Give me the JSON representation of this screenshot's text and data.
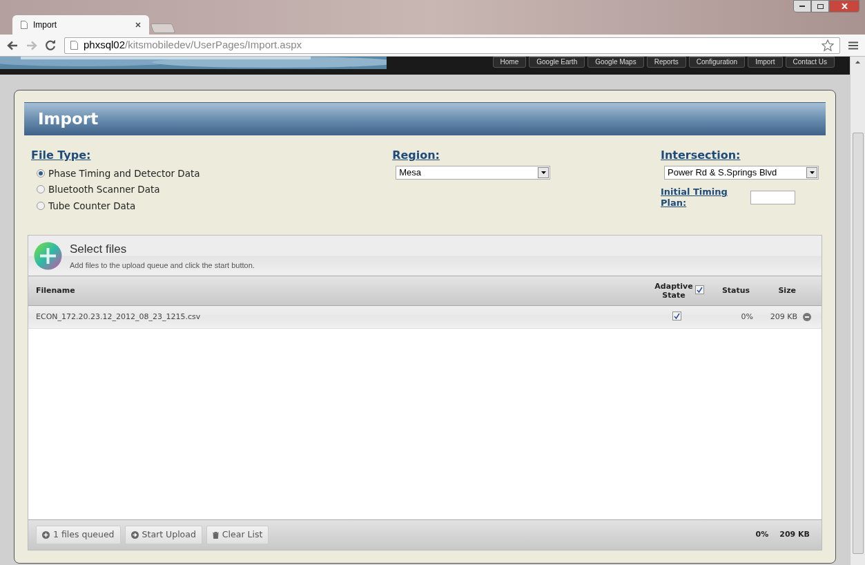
{
  "browser": {
    "tab_title": "Import",
    "url_host": "phxsql02",
    "url_path": "/kitsmobiledev/UserPages/Import.aspx"
  },
  "nav": [
    {
      "label": "Home"
    },
    {
      "label": "Google Earth"
    },
    {
      "label": "Google Maps"
    },
    {
      "label": "Reports"
    },
    {
      "label": "Configuration"
    },
    {
      "label": "Import"
    },
    {
      "label": "Contact Us"
    }
  ],
  "page_title": "Import",
  "file_type": {
    "label": "File Type:",
    "options": [
      {
        "label": "Phase Timing and Detector Data",
        "selected": true
      },
      {
        "label": "Bluetooth Scanner Data",
        "selected": false
      },
      {
        "label": "Tube Counter Data",
        "selected": false
      }
    ]
  },
  "region": {
    "label": "Region:",
    "value": "Mesa"
  },
  "intersection": {
    "label": "Intersection:",
    "value": "Power Rd & S.Springs Blvd"
  },
  "initial_timing_plan": {
    "label": "Initial Timing Plan:"
  },
  "uploader": {
    "title": "Select files",
    "subtitle": "Add files to the upload queue and click the start button.",
    "columns": {
      "filename": "Filename",
      "adaptive": "Adaptive State",
      "adaptive_checked": true,
      "status": "Status",
      "size": "Size"
    },
    "files": [
      {
        "name": "ECON_172.20.23.12_2012_08_23_1215.csv",
        "adaptive": true,
        "status": "0%",
        "size": "209 KB"
      }
    ],
    "buttons": [
      {
        "kind": "plus",
        "label": "1 files queued"
      },
      {
        "kind": "arrow",
        "label": "Start Upload"
      },
      {
        "kind": "trash",
        "label": "Clear List"
      }
    ],
    "total_status": "0%",
    "total_size": "209 KB"
  }
}
